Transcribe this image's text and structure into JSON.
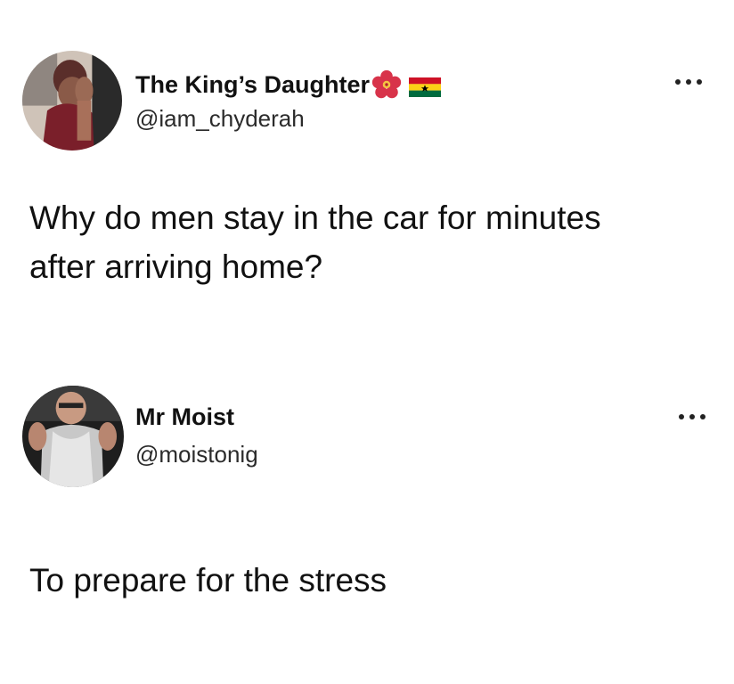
{
  "tweets": [
    {
      "author": {
        "display_name": "The King’s Daughter",
        "handle": "@iam_chyderah",
        "name_emojis": [
          "flower-icon",
          "flag-icon"
        ]
      },
      "text_lines": [
        "Why do men stay in the car for minutes",
        "after arriving home?"
      ],
      "more_icon": "more-horizontal-icon"
    },
    {
      "author": {
        "display_name": "Mr Moist",
        "handle": "@moistonig"
      },
      "text_lines": [
        "To prepare for the stress"
      ],
      "more_icon": "more-horizontal-icon"
    }
  ],
  "colors": {
    "background": "#ffffff",
    "text": "#111111",
    "handle": "#2b2b2b"
  }
}
